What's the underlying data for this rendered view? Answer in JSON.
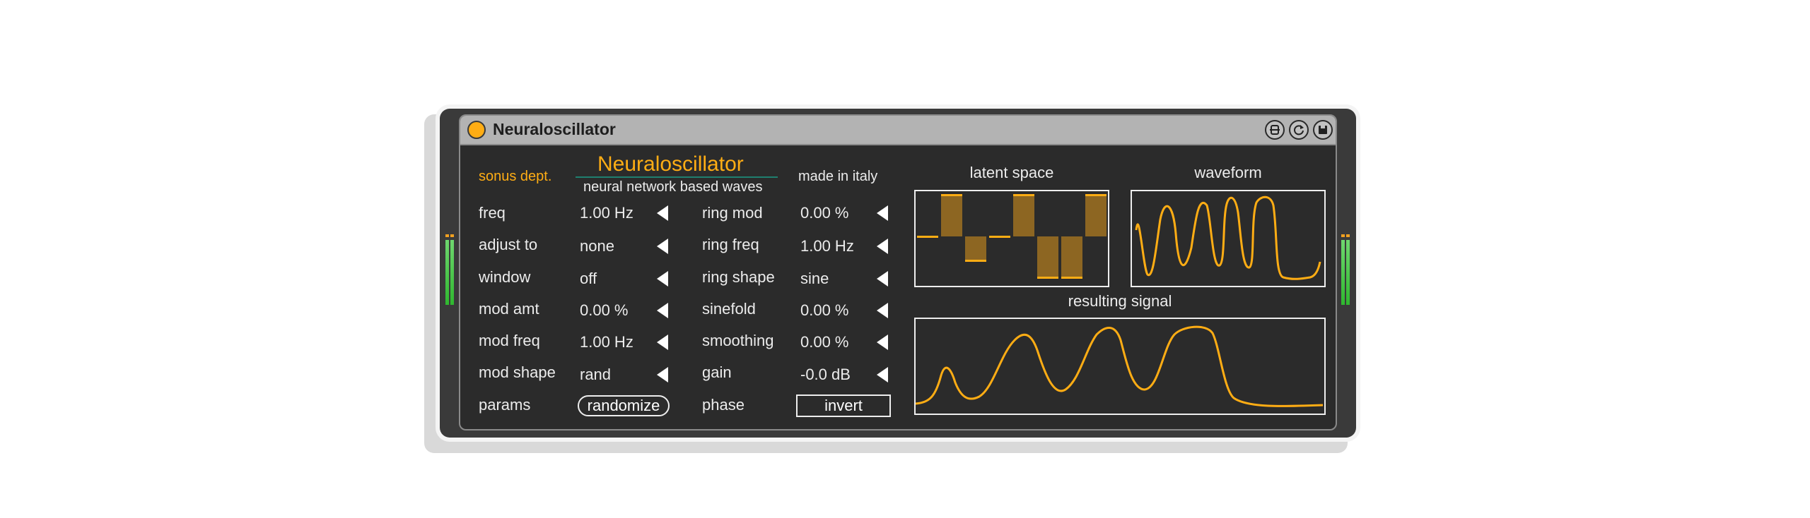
{
  "device": {
    "title": "Neuraloscillator",
    "brand": "sonus dept.",
    "header_title": "Neuraloscillator",
    "header_subtitle": "neural network based waves",
    "origin": "made in italy"
  },
  "titlebar_icons": [
    "hot-swap-icon",
    "reload-icon",
    "save-icon"
  ],
  "left_params": [
    {
      "label": "freq",
      "value": "1.00 Hz"
    },
    {
      "label": "adjust to",
      "value": "none"
    },
    {
      "label": "window",
      "value": "off"
    },
    {
      "label": "mod amt",
      "value": "0.00 %"
    },
    {
      "label": "mod freq",
      "value": "1.00 Hz"
    },
    {
      "label": "mod shape",
      "value": "rand"
    }
  ],
  "right_params": [
    {
      "label": "ring mod",
      "value": "0.00 %"
    },
    {
      "label": "ring freq",
      "value": "1.00 Hz"
    },
    {
      "label": "ring shape",
      "value": "sine"
    },
    {
      "label": "sinefold",
      "value": "0.00 %"
    },
    {
      "label": "smoothing",
      "value": "0.00 %"
    },
    {
      "label": "gain",
      "value": "-0.0 dB"
    }
  ],
  "params_row": {
    "label": "params",
    "button": "randomize"
  },
  "phase_row": {
    "label": "phase",
    "button": "invert"
  },
  "panels": {
    "latent": {
      "label": "latent space",
      "values": [
        0.0,
        1.0,
        -0.6,
        0.0,
        1.0,
        -1.0,
        -1.0,
        1.0
      ]
    },
    "waveform": {
      "label": "waveform"
    },
    "resulting": {
      "label": "resulting signal"
    }
  },
  "colors": {
    "accent": "#ffad14",
    "bar_fill": "#8d6622",
    "panel_bg": "#2b2b2b"
  }
}
